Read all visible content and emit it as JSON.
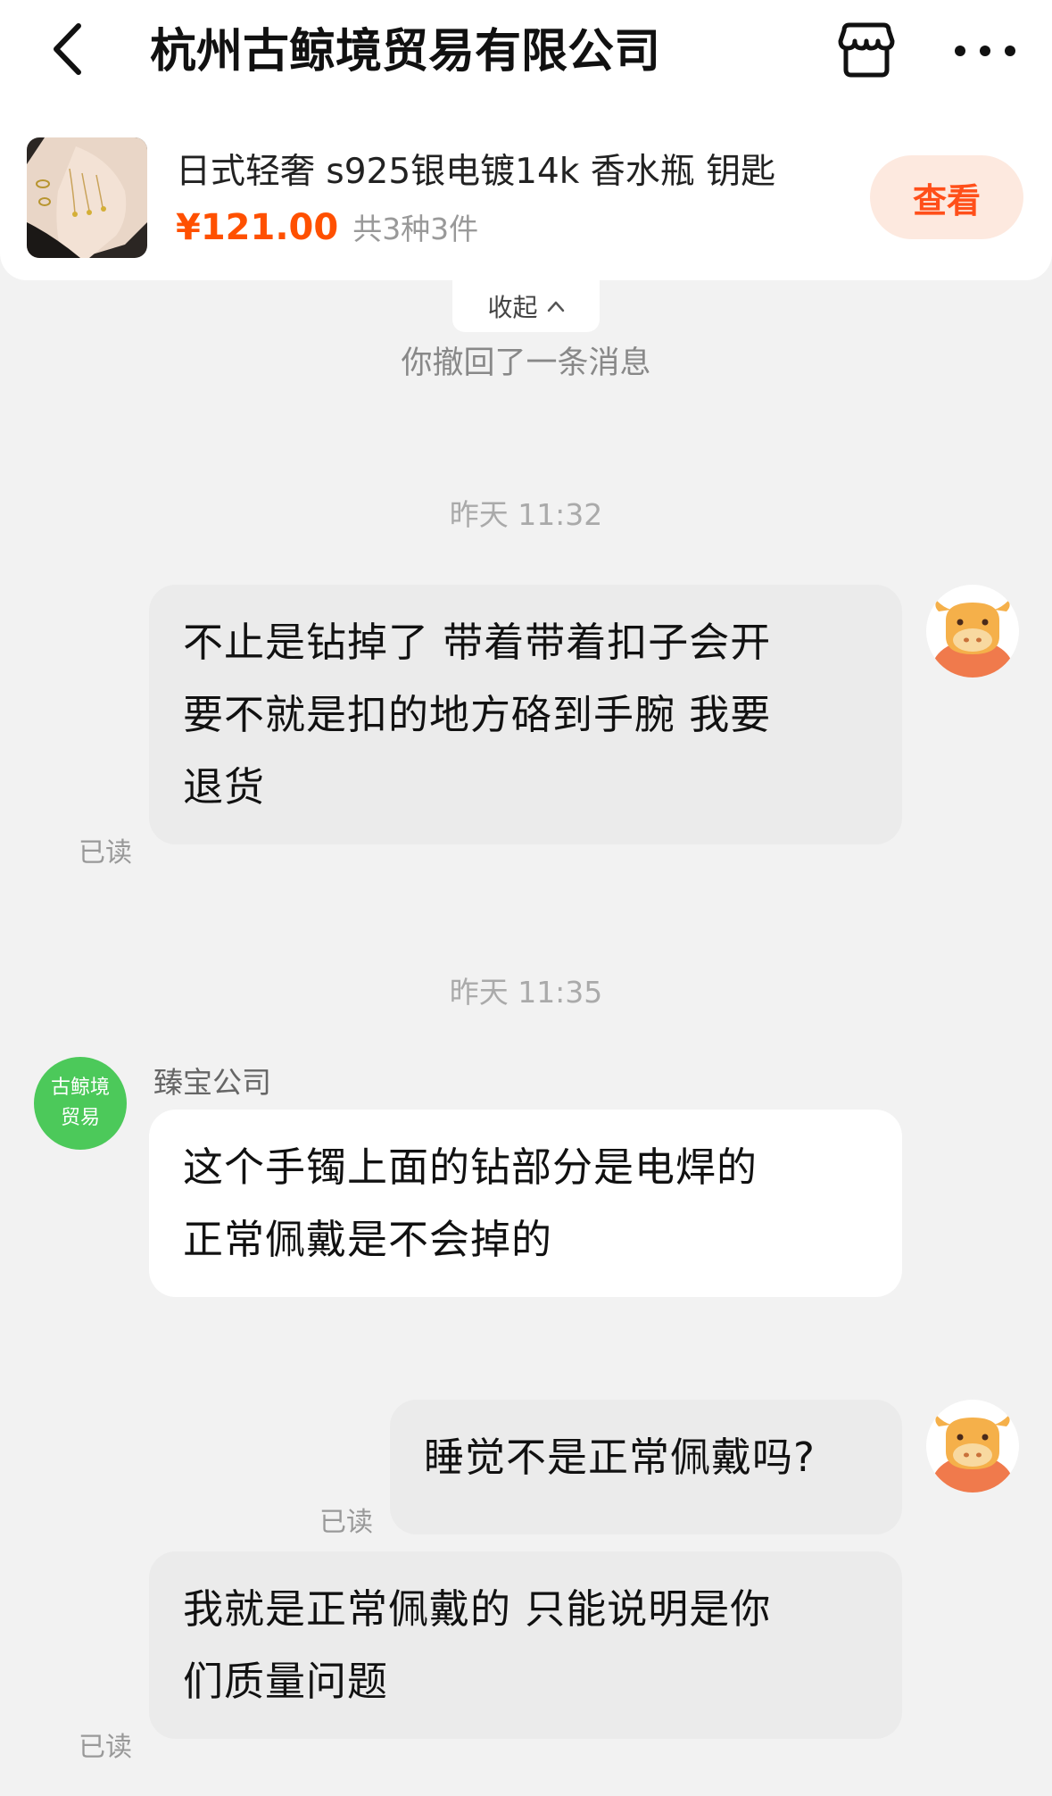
{
  "header": {
    "title": "杭州古鲸境贸易有限公司",
    "back_icon": "chevron-left-icon",
    "shop_icon": "store-icon",
    "more_icon": "more-horizontal-icon"
  },
  "product": {
    "name": "日式轻奢 s925银电镀14k 香水瓶 钥匙",
    "price": "¥121.00",
    "quantity": "共3种3件",
    "view_label": "查看"
  },
  "collapse_label": "收起",
  "system_notice": "你撤回了一条消息",
  "messages": [
    {
      "time": "昨天 11:32",
      "side": "out",
      "lines": [
        "不止是钻掉了 带着带着扣子会开",
        "要不就是扣的地方硌到手腕 我要",
        "退货"
      ],
      "read": "已读"
    },
    {
      "time": "昨天 11:35",
      "side": "in",
      "sender": "臻宝公司",
      "avatar_lines": [
        "古鲸境",
        "贸易"
      ],
      "lines": [
        "这个手镯上面的钻部分是电焊的",
        "正常佩戴是不会掉的"
      ]
    },
    {
      "side": "out",
      "lines": [
        "睡觉不是正常佩戴吗?"
      ],
      "read": "已读"
    },
    {
      "side": "out",
      "lines": [
        "我就是正常佩戴的 只能说明是你",
        "们质量问题"
      ],
      "read": "已读"
    }
  ],
  "colors": {
    "accent": "#ff5000",
    "view_button_bg": "#fde9df",
    "chat_bg": "#f2f2f2",
    "out_bubble": "#ebebeb",
    "in_bubble": "#ffffff",
    "shop_avatar": "#4cc95a",
    "user_avatar": "#f07a4c"
  }
}
